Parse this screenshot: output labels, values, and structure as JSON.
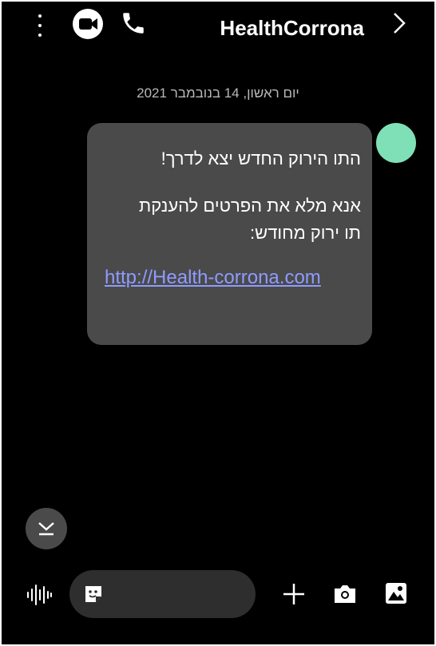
{
  "header": {
    "title": "HealthCorrona",
    "icons": [
      "kebab-menu-icon",
      "video-call-icon",
      "phone-icon",
      "chevron-right-icon"
    ]
  },
  "conversation": {
    "date": "יום ראשון, 14 בנובמבר 2021",
    "message": {
      "line1": "התו הירוק החדש יצא לדרך!",
      "line2": "אנא מלא את הפרטים להענקת",
      "line3": "תו ירוק מחודש:",
      "link": "http://Health-corrona.com"
    },
    "avatar_color": "#7fe0b8",
    "bubble_color": "#4a4a4a"
  },
  "composer": {
    "icons": [
      "voice-wave-icon",
      "sticker-icon",
      "plus-icon",
      "camera-icon",
      "gallery-icon"
    ]
  }
}
